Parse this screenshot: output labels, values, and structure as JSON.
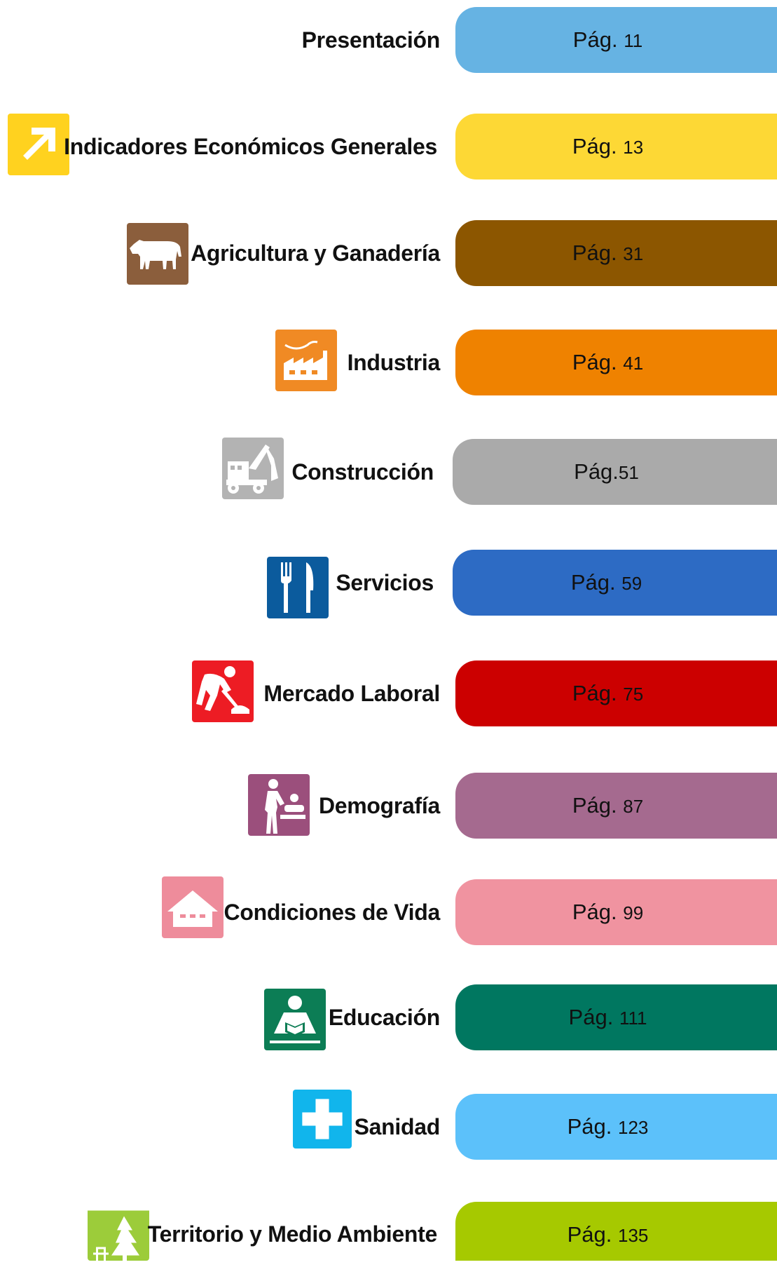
{
  "toc": {
    "items": [
      {
        "title": "Presentación",
        "page_prefix": "Pág.",
        "page_number": "11",
        "color": "#66b3e3",
        "icon": "none"
      },
      {
        "title": "Indicadores Económicos Generales",
        "page_prefix": "Pág.",
        "page_number": "13",
        "color": "#fdd835",
        "icon": "arrow-up-right-icon"
      },
      {
        "title": "Agricultura y Ganadería",
        "page_prefix": "Pág.",
        "page_number": "31",
        "color": "#8c5600",
        "icon": "cow-icon"
      },
      {
        "title": "Industria",
        "page_prefix": "Pág.",
        "page_number": "41",
        "color": "#ef8200",
        "icon": "factory-icon"
      },
      {
        "title": "Construcción",
        "page_prefix": "Pág.",
        "page_number": "51",
        "color": "#aaaaaa",
        "icon": "excavator-icon"
      },
      {
        "title": "Servicios",
        "page_prefix": "Pág.",
        "page_number": "59",
        "color": "#2d6bc4",
        "icon": "fork-knife-icon"
      },
      {
        "title": "Mercado Laboral",
        "page_prefix": "Pág.",
        "page_number": "75",
        "color": "#cc0000",
        "icon": "worker-shovel-icon"
      },
      {
        "title": "Demografía",
        "page_prefix": "Pág.",
        "page_number": "87",
        "color": "#a56a8f",
        "icon": "baby-changing-icon"
      },
      {
        "title": "Condiciones de Vida",
        "page_prefix": "Pág.",
        "page_number": "99",
        "color": "#f093a0",
        "icon": "house-icon"
      },
      {
        "title": "Educación",
        "page_prefix": "Pág.",
        "page_number": "111",
        "color": "#007760",
        "icon": "reader-icon"
      },
      {
        "title": "Sanidad",
        "page_prefix": "Pág.",
        "page_number": "123",
        "color": "#5cc1fa",
        "icon": "medical-cross-icon"
      },
      {
        "title": "Territorio y Medio Ambiente",
        "page_prefix": "Pág.",
        "page_number": "135",
        "color": "#a6c900",
        "icon": "tree-picnic-icon"
      }
    ]
  }
}
